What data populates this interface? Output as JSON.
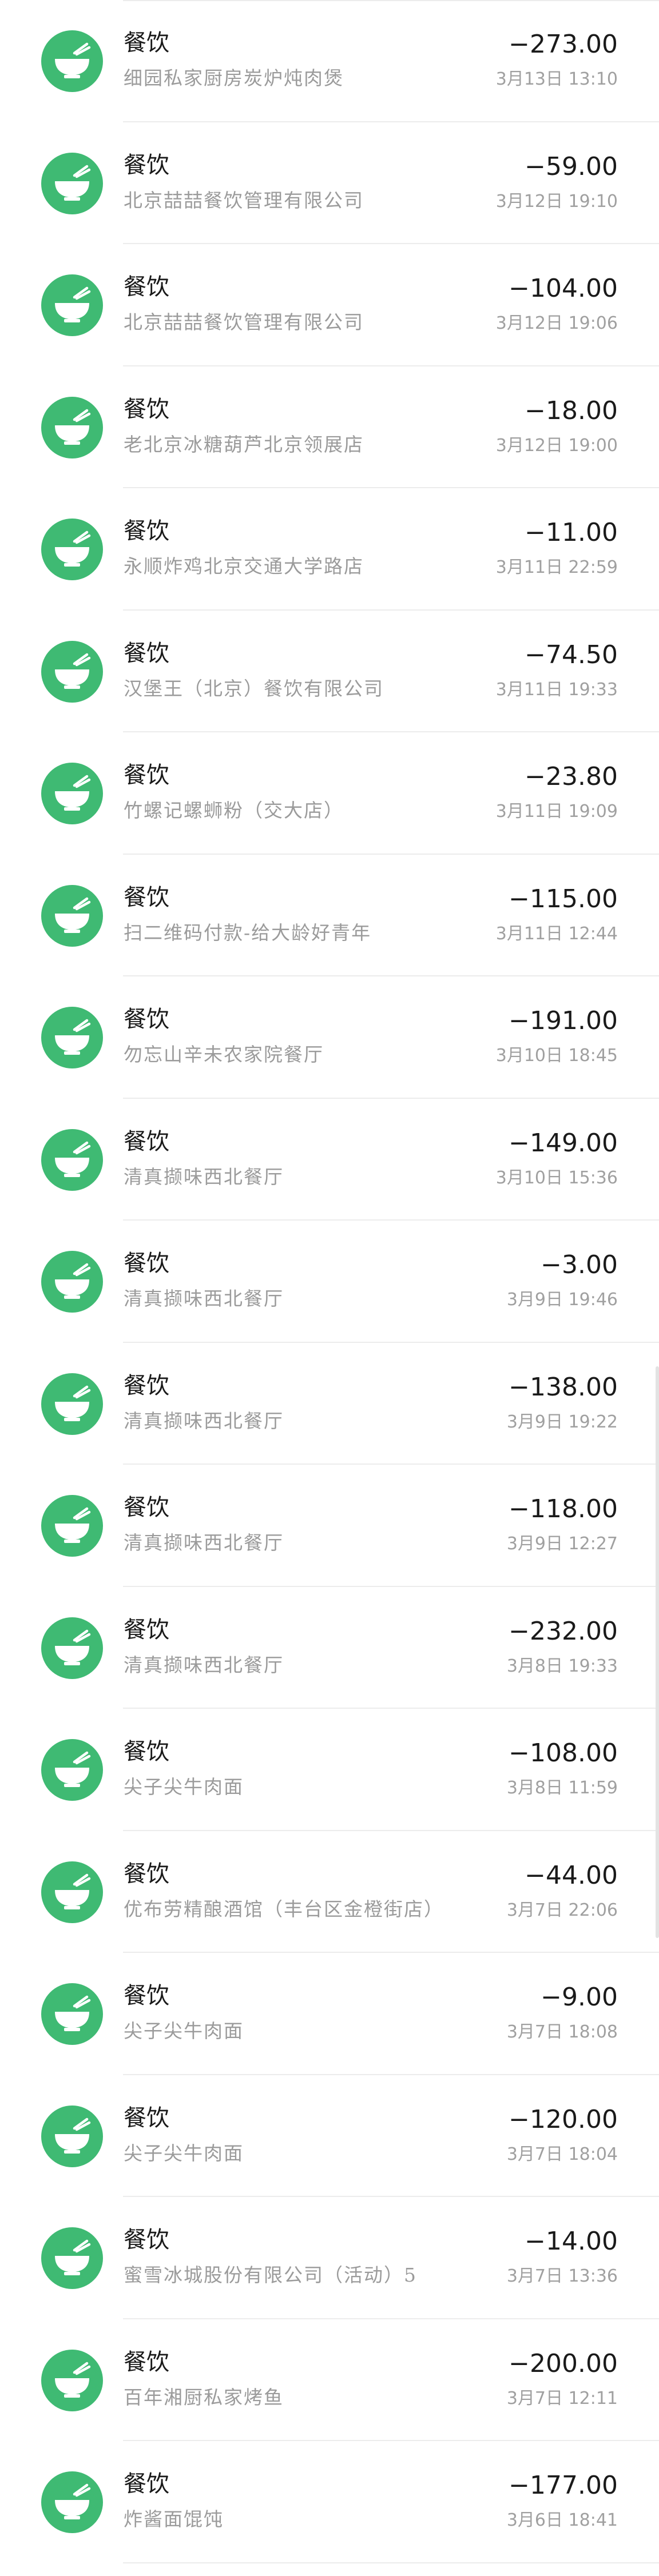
{
  "transactions": [
    {
      "category": "餐饮",
      "merchant": "细园私家厨房炭炉炖肉煲",
      "amount": "−273.00",
      "time": "3月13日 13:10",
      "icon": "rice-bowl-icon"
    },
    {
      "category": "餐饮",
      "merchant": "北京喆喆餐饮管理有限公司",
      "amount": "−59.00",
      "time": "3月12日 19:10",
      "icon": "rice-bowl-icon"
    },
    {
      "category": "餐饮",
      "merchant": "北京喆喆餐饮管理有限公司",
      "amount": "−104.00",
      "time": "3月12日 19:06",
      "icon": "rice-bowl-icon"
    },
    {
      "category": "餐饮",
      "merchant": "老北京冰糖葫芦北京领展店",
      "amount": "−18.00",
      "time": "3月12日 19:00",
      "icon": "rice-bowl-icon"
    },
    {
      "category": "餐饮",
      "merchant": "永顺炸鸡北京交通大学路店",
      "amount": "−11.00",
      "time": "3月11日 22:59",
      "icon": "rice-bowl-icon"
    },
    {
      "category": "餐饮",
      "merchant": "汉堡王（北京）餐饮有限公司",
      "amount": "−74.50",
      "time": "3月11日 19:33",
      "icon": "rice-bowl-icon"
    },
    {
      "category": "餐饮",
      "merchant": "竹螺记螺蛳粉（交大店）",
      "amount": "−23.80",
      "time": "3月11日 19:09",
      "icon": "rice-bowl-icon"
    },
    {
      "category": "餐饮",
      "merchant": "扫二维码付款-给大龄好青年",
      "amount": "−115.00",
      "time": "3月11日 12:44",
      "icon": "rice-bowl-icon"
    },
    {
      "category": "餐饮",
      "merchant": "勿忘山辛未农家院餐厅",
      "amount": "−191.00",
      "time": "3月10日 18:45",
      "icon": "rice-bowl-icon"
    },
    {
      "category": "餐饮",
      "merchant": "清真撷味西北餐厅",
      "amount": "−149.00",
      "time": "3月10日 15:36",
      "icon": "rice-bowl-icon"
    },
    {
      "category": "餐饮",
      "merchant": "清真撷味西北餐厅",
      "amount": "−3.00",
      "time": "3月9日 19:46",
      "icon": "rice-bowl-icon"
    },
    {
      "category": "餐饮",
      "merchant": "清真撷味西北餐厅",
      "amount": "−138.00",
      "time": "3月9日 19:22",
      "icon": "rice-bowl-icon"
    },
    {
      "category": "餐饮",
      "merchant": "清真撷味西北餐厅",
      "amount": "−118.00",
      "time": "3月9日 12:27",
      "icon": "rice-bowl-icon"
    },
    {
      "category": "餐饮",
      "merchant": "清真撷味西北餐厅",
      "amount": "−232.00",
      "time": "3月8日 19:33",
      "icon": "rice-bowl-icon"
    },
    {
      "category": "餐饮",
      "merchant": "尖子尖牛肉面",
      "amount": "−108.00",
      "time": "3月8日 11:59",
      "icon": "rice-bowl-icon"
    },
    {
      "category": "餐饮",
      "merchant": "优布劳精酿酒馆（丰台区金橙街店）",
      "amount": "−44.00",
      "time": "3月7日 22:06",
      "icon": "rice-bowl-icon"
    },
    {
      "category": "餐饮",
      "merchant": "尖子尖牛肉面",
      "amount": "−9.00",
      "time": "3月7日 18:08",
      "icon": "rice-bowl-icon"
    },
    {
      "category": "餐饮",
      "merchant": "尖子尖牛肉面",
      "amount": "−120.00",
      "time": "3月7日 18:04",
      "icon": "rice-bowl-icon"
    },
    {
      "category": "餐饮",
      "merchant": "蜜雪冰城股份有限公司（活动）5",
      "amount": "−14.00",
      "time": "3月7日 13:36",
      "icon": "rice-bowl-icon"
    },
    {
      "category": "餐饮",
      "merchant": "百年湘厨私家烤鱼",
      "amount": "−200.00",
      "time": "3月7日 12:11",
      "icon": "rice-bowl-icon"
    },
    {
      "category": "餐饮",
      "merchant": "炸酱面馄饨",
      "amount": "−177.00",
      "time": "3月6日 18:41",
      "icon": "rice-bowl-icon"
    }
  ],
  "colors": {
    "icon_bg": "#3fba73",
    "icon_fg": "#ffffff",
    "divider": "#ececec",
    "secondary_text": "#9b9b9b"
  }
}
